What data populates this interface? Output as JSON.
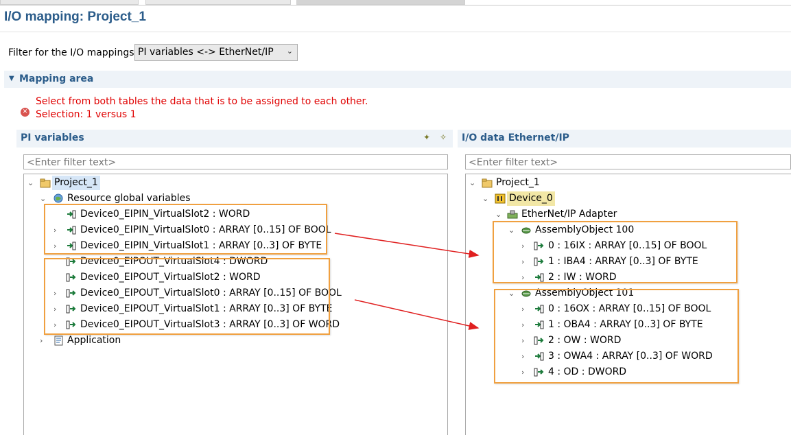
{
  "page_title": "I/O mapping: Project_1",
  "filter": {
    "label": "Filter for the I/O mappings:",
    "selected": "PI variables <-> EtherNet/IP"
  },
  "mapping_area": {
    "label": "Mapping area"
  },
  "messages": {
    "line1": "Select from both tables the data that is to be assigned to each other.",
    "line2": "Selection: 1 versus 1"
  },
  "left_panel": {
    "title": "PI variables",
    "filter_placeholder": "<Enter filter text>",
    "project": "Project_1",
    "resource": "Resource global variables",
    "variables": [
      "Device0_EIPIN_VirtualSlot2 : WORD",
      "Device0_EIPIN_VirtualSlot0 : ARRAY [0..15] OF BOOL",
      "Device0_EIPIN_VirtualSlot1 : ARRAY [0..3] OF BYTE",
      "Device0_EIPOUT_VirtualSlot4 : DWORD",
      "Device0_EIPOUT_VirtualSlot2 : WORD",
      "Device0_EIPOUT_VirtualSlot0 : ARRAY [0..15] OF BOOL",
      "Device0_EIPOUT_VirtualSlot1 : ARRAY [0..3] OF BYTE",
      "Device0_EIPOUT_VirtualSlot3 : ARRAY [0..3] OF WORD"
    ],
    "application": "Application"
  },
  "right_panel": {
    "title": "I/O data Ethernet/IP",
    "filter_placeholder": "<Enter filter text>",
    "project": "Project_1",
    "device": "Device_0",
    "adapter": "EtherNet/IP Adapter",
    "assembly_100": {
      "name": "AssemblyObject 100",
      "items": [
        "0 : 16IX : ARRAY [0..15] OF BOOL",
        "1 : IBA4 : ARRAY [0..3] OF BYTE",
        "2 : IW : WORD"
      ]
    },
    "assembly_101": {
      "name": "AssemblyObject 101",
      "items": [
        "0 : 16OX : ARRAY [0..15] OF BOOL",
        "1 : OBA4 : ARRAY [0..3] OF BYTE",
        "2 : OW : WORD",
        "3 : OWA4 : ARRAY [0..3] OF WORD",
        "4 : OD : DWORD"
      ]
    }
  },
  "colors": {
    "accent": "#2b5c8a",
    "error": "#e00000",
    "highlight_box": "#f0a040",
    "arrow": "#e02020"
  }
}
